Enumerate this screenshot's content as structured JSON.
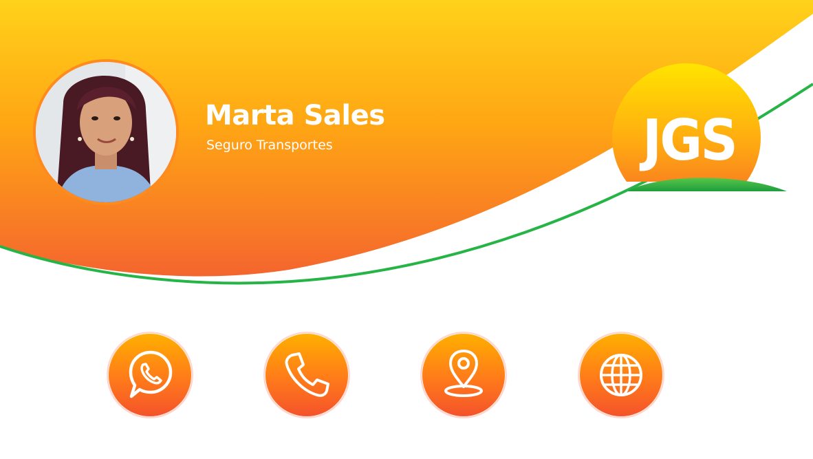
{
  "profile": {
    "name": "Marta Sales",
    "subtitle": "Seguro Transportes"
  },
  "logo": {
    "text": "JGS"
  },
  "colors": {
    "gradient_top": "#ffd21a",
    "gradient_bottom": "#f4652e",
    "accent_green": "#27b446",
    "icon_top": "#ffb000",
    "icon_bottom": "#f4522b"
  },
  "contact_buttons": [
    {
      "icon": "whatsapp-icon"
    },
    {
      "icon": "phone-icon"
    },
    {
      "icon": "location-pin-icon"
    },
    {
      "icon": "globe-icon"
    }
  ]
}
